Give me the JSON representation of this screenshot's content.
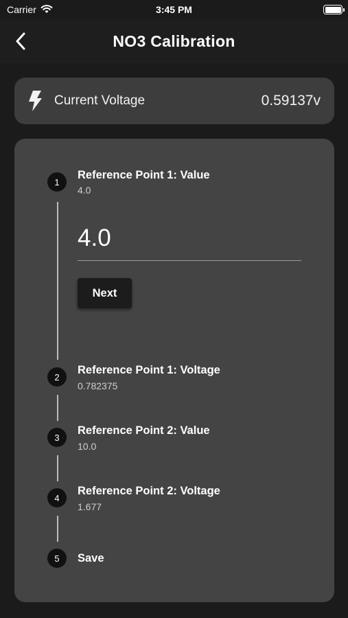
{
  "status_bar": {
    "carrier": "Carrier",
    "time": "3:45 PM"
  },
  "nav": {
    "title": "NO3 Calibration"
  },
  "voltage": {
    "label": "Current Voltage",
    "value": "0.59137v"
  },
  "steps": [
    {
      "number": "1",
      "title": "Reference Point 1: Value",
      "subtitle": "4.0"
    },
    {
      "number": "2",
      "title": "Reference Point 1: Voltage",
      "subtitle": "0.782375"
    },
    {
      "number": "3",
      "title": "Reference Point 2: Value",
      "subtitle": "10.0"
    },
    {
      "number": "4",
      "title": "Reference Point 2: Voltage",
      "subtitle": "1.677"
    },
    {
      "number": "5",
      "title": "Save",
      "subtitle": ""
    }
  ],
  "active_step": {
    "input_value": "4.0",
    "next_label": "Next"
  },
  "colors": {
    "background": "#1b1b1b",
    "card": "#444444",
    "voltage_card": "#3d3d3d",
    "step_circle": "#111111"
  }
}
